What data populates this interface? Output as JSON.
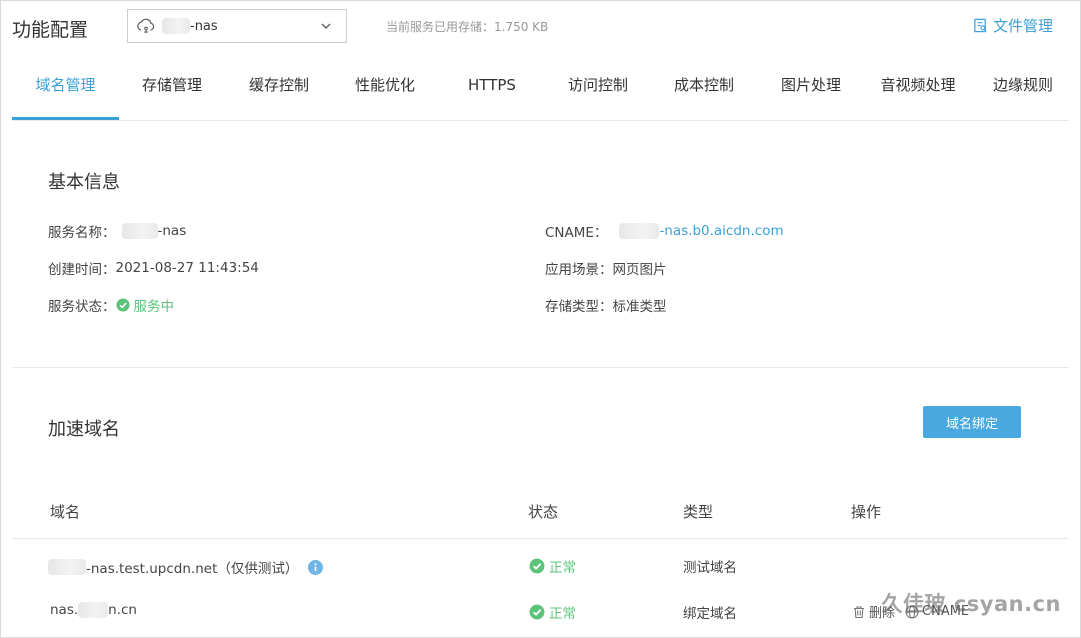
{
  "header": {
    "title": "功能配置",
    "service_value": "-nas",
    "storage_info": "当前服务已用存储：1.750 KB",
    "file_mgmt_label": "文件管理"
  },
  "tabs": [
    {
      "label": "域名管理",
      "active": true
    },
    {
      "label": "存储管理"
    },
    {
      "label": "缓存控制"
    },
    {
      "label": "性能优化"
    },
    {
      "label": "HTTPS"
    },
    {
      "label": "访问控制"
    },
    {
      "label": "成本控制"
    },
    {
      "label": "图片处理"
    },
    {
      "label": "音视频处理"
    },
    {
      "label": "边缘规则"
    }
  ],
  "basic": {
    "title": "基本信息",
    "service_name_label": "服务名称：",
    "service_name_value": "-nas",
    "created_label": "创建时间：",
    "created_value": "2021-08-27 11:43:54",
    "status_label": "服务状态：",
    "status_value": "服务中",
    "cname_label": "CNAME：",
    "cname_value": "-nas.b0.aicdn.com",
    "scene_label": "应用场景：",
    "scene_value": "网页图片",
    "storage_type_label": "存储类型：",
    "storage_type_value": "标准类型"
  },
  "domains": {
    "title": "加速域名",
    "bind_button": "域名绑定",
    "columns": [
      "域名",
      "状态",
      "类型",
      "操作"
    ],
    "rows": [
      {
        "domain": "-nas.test.upcdn.net（仅供测试）",
        "status": "正常",
        "type": "测试域名"
      },
      {
        "domain_prefix": "nas.",
        "domain_suffix": "n.cn",
        "status": "正常",
        "type": "绑定域名",
        "op_delete": "删除",
        "op_cname": "CNAME"
      }
    ]
  },
  "colors": {
    "accent": "#3ba0d8",
    "ok": "#5cc47a",
    "button": "#4aa8e0"
  },
  "watermark": "久佳玻 csyan.cn"
}
